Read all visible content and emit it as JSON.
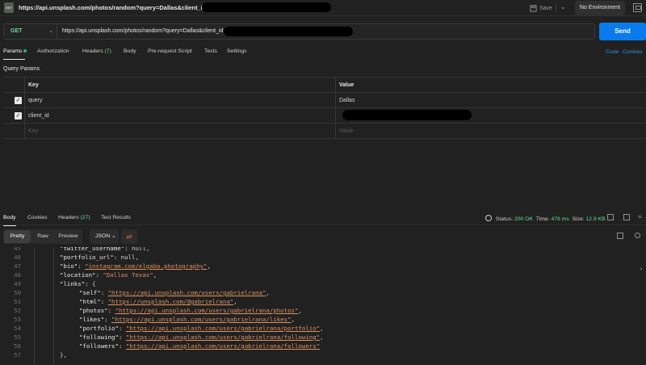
{
  "topbar": {
    "icon_label": "GET",
    "title": "https://api.unsplash.com/photos/random?query=Dallas&client_id",
    "save_label": "Save",
    "environment": "No Environment"
  },
  "request": {
    "method": "GET",
    "url": "https://api.unsplash.com/photos/random?query=Dallas&client_id",
    "send_label": "Send"
  },
  "request_tabs": [
    {
      "label": "Params",
      "count": ""
    },
    {
      "label": "Authorization",
      "count": ""
    },
    {
      "label": "Headers",
      "count": "(7)"
    },
    {
      "label": "Body",
      "count": ""
    },
    {
      "label": "Pre-request Script",
      "count": ""
    },
    {
      "label": "Tests",
      "count": ""
    },
    {
      "label": "Settings",
      "count": ""
    }
  ],
  "links": {
    "code": "Code",
    "cookies": "Cookies"
  },
  "query_params": {
    "title": "Query Params",
    "headers": {
      "key": "Key",
      "value": "Value"
    },
    "rows": [
      {
        "key": "query",
        "value": "Dallas",
        "checked": true
      },
      {
        "key": "client_id",
        "value": "",
        "checked": true
      }
    ],
    "placeholder": {
      "key": "Key",
      "value": "Value"
    }
  },
  "response_tabs": [
    {
      "label": "Body",
      "count": ""
    },
    {
      "label": "Cookies",
      "count": ""
    },
    {
      "label": "Headers",
      "count": "(27)"
    },
    {
      "label": "Test Results",
      "count": ""
    }
  ],
  "response_status": {
    "status_label": "Status:",
    "status": "200 OK",
    "time_label": "Time:",
    "time": "478 ms",
    "size_label": "Size:",
    "size": "12.9 KB"
  },
  "view_modes": [
    "Pretty",
    "Raw",
    "Preview"
  ],
  "active_view": "Pretty",
  "format": "JSON",
  "code_lines": [
    {
      "n": "45",
      "indent": 1,
      "key": "twitter_username",
      "val": "null",
      "type": "n",
      "end": ","
    },
    {
      "n": "46",
      "indent": 1,
      "key": "portfolio_url",
      "val": "null",
      "type": "n",
      "end": ","
    },
    {
      "n": "47",
      "indent": 1,
      "key": "bio",
      "val": "\"instagram.com/elgabo.photography\"",
      "type": "u",
      "end": ","
    },
    {
      "n": "48",
      "indent": 1,
      "key": "location",
      "val": "\"Dallas Texas\"",
      "type": "s",
      "end": ","
    },
    {
      "n": "49",
      "indent": 1,
      "key": "links",
      "val": "{",
      "type": "p",
      "end": ""
    },
    {
      "n": "50",
      "indent": 2,
      "key": "self",
      "val": "\"https://api.unsplash.com/users/gabrielrana\"",
      "type": "u",
      "end": ","
    },
    {
      "n": "51",
      "indent": 2,
      "key": "html",
      "val": "\"https://unsplash.com/@gabrielrana\"",
      "type": "u",
      "end": ","
    },
    {
      "n": "52",
      "indent": 2,
      "key": "photos",
      "val": "\"https://api.unsplash.com/users/gabrielrana/photos\"",
      "type": "u",
      "end": ","
    },
    {
      "n": "53",
      "indent": 2,
      "key": "likes",
      "val": "\"https://api.unsplash.com/users/gabrielrana/likes\"",
      "type": "u",
      "end": ","
    },
    {
      "n": "54",
      "indent": 2,
      "key": "portfolio",
      "val": "\"https://api.unsplash.com/users/gabrielrana/portfolio\"",
      "type": "u",
      "end": ","
    },
    {
      "n": "55",
      "indent": 2,
      "key": "following",
      "val": "\"https://api.unsplash.com/users/gabrielrana/following\"",
      "type": "u",
      "end": ","
    },
    {
      "n": "56",
      "indent": 2,
      "key": "followers",
      "val": "\"https://api.unsplash.com/users/gabrielrana/followers\"",
      "type": "u",
      "end": ""
    },
    {
      "n": "57",
      "indent": 1,
      "key": "",
      "val": "},",
      "type": "p",
      "end": ""
    }
  ],
  "colors": {
    "send": "#097bed",
    "method": "#6bdd9a",
    "string": "#e0925f",
    "link": "#3a8fd6",
    "status_ok": "#6bdd9a"
  }
}
